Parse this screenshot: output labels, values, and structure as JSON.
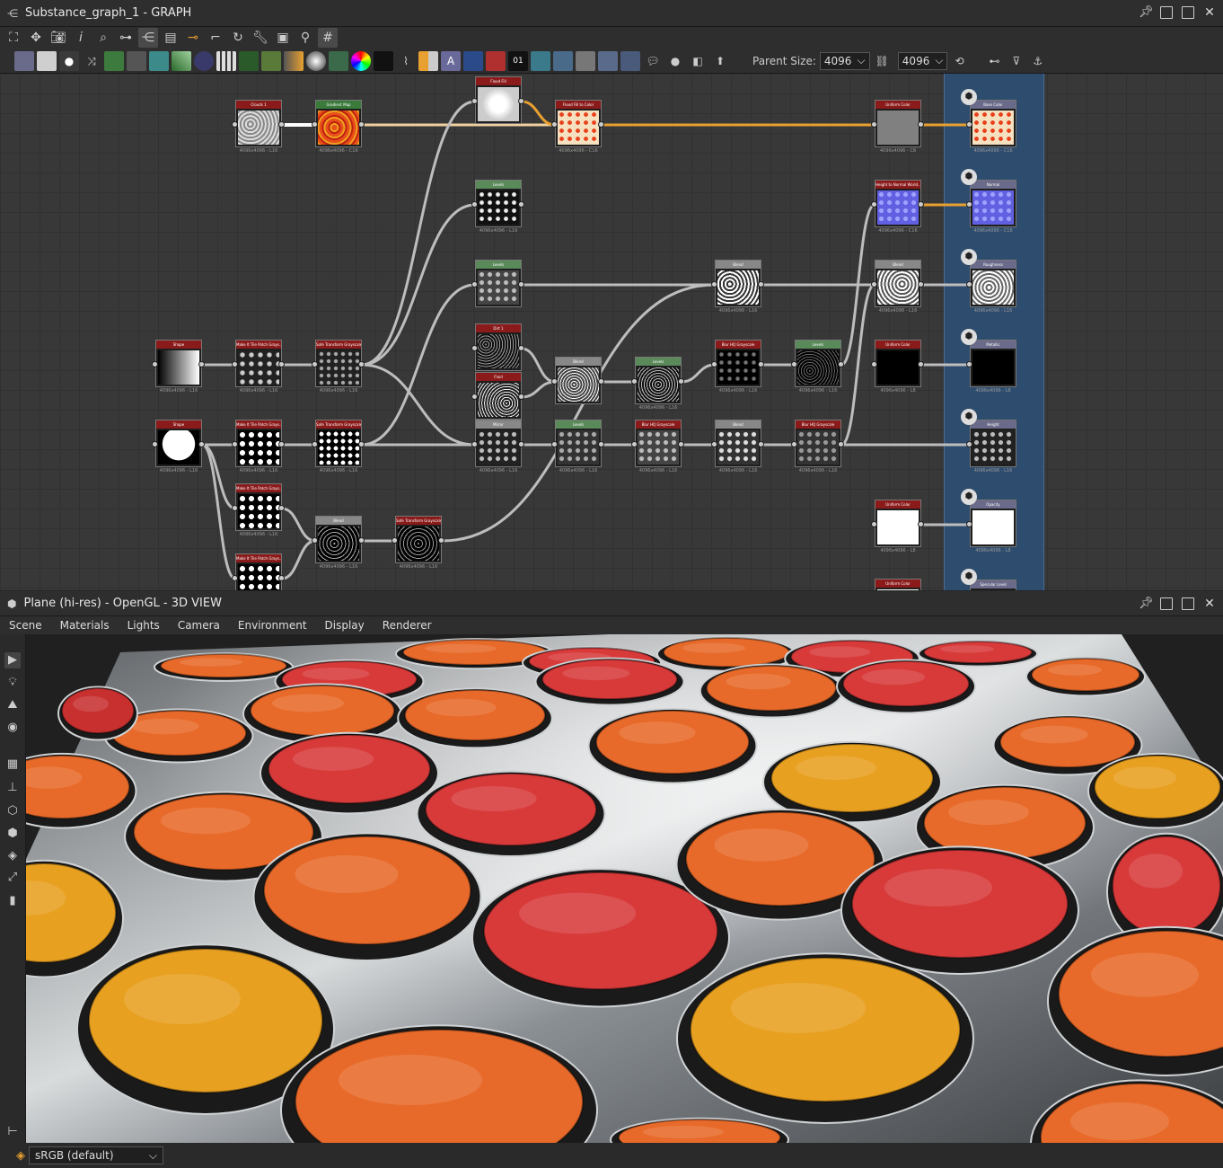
{
  "graph_window": {
    "title": "Substance_graph_1 - GRAPH"
  },
  "toolbar2": {
    "parent_size_label": "Parent Size:",
    "parent_size_w": "4096",
    "parent_size_h": "4096"
  },
  "nodes": [
    {
      "id": "clouds1",
      "title": "Clouds 1",
      "caption": "4096x4096 - L16",
      "header_color": "#8b1a1a"
    },
    {
      "id": "gradient_map",
      "title": "Gradient Map",
      "caption": "4096x4096 - C16",
      "header_color": "#3a7a3a"
    },
    {
      "id": "flood_fill",
      "title": "Flood Fill",
      "caption": "",
      "header_color": "#8b1a1a"
    },
    {
      "id": "flood_fill_to_color",
      "title": "Flood Fill to Color",
      "caption": "4096x4096 - C16",
      "header_color": "#8b1a1a"
    },
    {
      "id": "uniform_color_1",
      "title": "Uniform Color",
      "caption": "4096x4096 - C8",
      "header_color": "#8b1a1a"
    },
    {
      "id": "levels_1",
      "title": "Levels",
      "caption": "4096x4096 - L16",
      "header_color": "#5a8a5a"
    },
    {
      "id": "levels_2",
      "title": "Levels",
      "caption": "",
      "header_color": "#5a8a5a"
    },
    {
      "id": "height_to_normal",
      "title": "Height to Normal World...",
      "caption": "4096x4096 - C16",
      "header_color": "#8b1a1a"
    },
    {
      "id": "blend_1",
      "title": "Blend",
      "caption": "4096x4096 - L16",
      "header_color": "#888888"
    },
    {
      "id": "blend_2",
      "title": "Blend",
      "caption": "4096x4096 - L16",
      "header_color": "#888888"
    },
    {
      "id": "shape_1",
      "title": "Shape",
      "caption": "4096x4096 - L16",
      "header_color": "#8b1a1a"
    },
    {
      "id": "tile_sampler_1",
      "title": "Make It Tile Patch Grays...",
      "caption": "4096x4096 - L16",
      "header_color": "#8b1a1a"
    },
    {
      "id": "safe_transform_1",
      "title": "Safe Transform Grayscale",
      "caption": "4096x4096 - L16",
      "header_color": "#8b1a1a"
    },
    {
      "id": "dirt1",
      "title": "Dirt 1",
      "caption": "",
      "header_color": "#8b1a1a"
    },
    {
      "id": "fluid",
      "title": "Fluid",
      "caption": "",
      "header_color": "#8b1a1a"
    },
    {
      "id": "blend_3",
      "title": "Blend",
      "caption": "",
      "header_color": "#888888"
    },
    {
      "id": "levels_3",
      "title": "Levels",
      "caption": "4096x4096 - L16",
      "header_color": "#5a8a5a"
    },
    {
      "id": "blur_hq_1",
      "title": "Blur HQ Grayscale",
      "caption": "4096x4096 - L16",
      "header_color": "#8b1a1a"
    },
    {
      "id": "levels_4",
      "title": "Levels",
      "caption": "4096x4096 - L16",
      "header_color": "#5a8a5a"
    },
    {
      "id": "uniform_color_2",
      "title": "Uniform Color",
      "caption": "4096x4096 - L8",
      "header_color": "#8b1a1a"
    },
    {
      "id": "shape_2",
      "title": "Shape",
      "caption": "4096x4096 - L16",
      "header_color": "#8b1a1a"
    },
    {
      "id": "tile_sampler_2",
      "title": "Make It Tile Patch Grays...",
      "caption": "4096x4096 - L16",
      "header_color": "#8b1a1a"
    },
    {
      "id": "safe_transform_2",
      "title": "Safe Transform Grayscale",
      "caption": "4096x4096 - L16",
      "header_color": "#8b1a1a"
    },
    {
      "id": "mirror",
      "title": "Mirror",
      "caption": "4096x4096 - L16",
      "header_color": "#888888"
    },
    {
      "id": "levels_5",
      "title": "Levels",
      "caption": "4096x4096 - L16",
      "header_color": "#5a8a5a"
    },
    {
      "id": "blur_hq_2",
      "title": "Blur HQ Grayscale",
      "caption": "4096x4096 - L16",
      "header_color": "#8b1a1a"
    },
    {
      "id": "blend_4",
      "title": "Blend",
      "caption": "4096x4096 - L16",
      "header_color": "#888888"
    },
    {
      "id": "blur_hq_3",
      "title": "Blur HQ Grayscale",
      "caption": "4096x4096 - L16",
      "header_color": "#8b1a1a"
    },
    {
      "id": "tile_sampler_3",
      "title": "Make It Tile Patch Grays...",
      "caption": "4096x4096 - L16",
      "header_color": "#8b1a1a"
    },
    {
      "id": "blend_5",
      "title": "Blend",
      "caption": "4096x4096 - L16",
      "header_color": "#888888"
    },
    {
      "id": "safe_transform_3",
      "title": "Safe Transform Grayscale",
      "caption": "4096x4096 - L16",
      "header_color": "#8b1a1a"
    },
    {
      "id": "tile_sampler_4",
      "title": "Make It Tile Patch Grays...",
      "caption": "",
      "header_color": "#8b1a1a"
    },
    {
      "id": "uniform_color_3",
      "title": "Uniform Color",
      "caption": "4096x4096 - L8",
      "header_color": "#8b1a1a"
    },
    {
      "id": "uniform_color_4",
      "title": "Uniform Color",
      "caption": "",
      "header_color": "#8b1a1a"
    }
  ],
  "outputs": [
    {
      "id": "basecolor",
      "title": "Base Color",
      "caption": "4096x4096 - C16"
    },
    {
      "id": "normal",
      "title": "Normal",
      "caption": "4096x4096 - C16"
    },
    {
      "id": "roughness",
      "title": "Roughness",
      "caption": "4096x4096 - L16"
    },
    {
      "id": "metallic",
      "title": "Metallic",
      "caption": "4096x4096 - L8"
    },
    {
      "id": "height",
      "title": "Height",
      "caption": "4096x4096 - L16"
    },
    {
      "id": "opacity",
      "title": "Opacity",
      "caption": "4096x4096 - L8"
    },
    {
      "id": "specular",
      "title": "Specular Level",
      "caption": ""
    }
  ],
  "view_window": {
    "title": "Plane (hi-res) - OpenGL - 3D VIEW"
  },
  "menu": [
    "Scene",
    "Materials",
    "Lights",
    "Camera",
    "Environment",
    "Display",
    "Renderer"
  ],
  "statusbar": {
    "colorspace": "sRGB (default)"
  },
  "colors": {
    "accent_orange": "#e8a030",
    "wire": "#bdbdbd",
    "output_panel": "#2e4c6e"
  }
}
